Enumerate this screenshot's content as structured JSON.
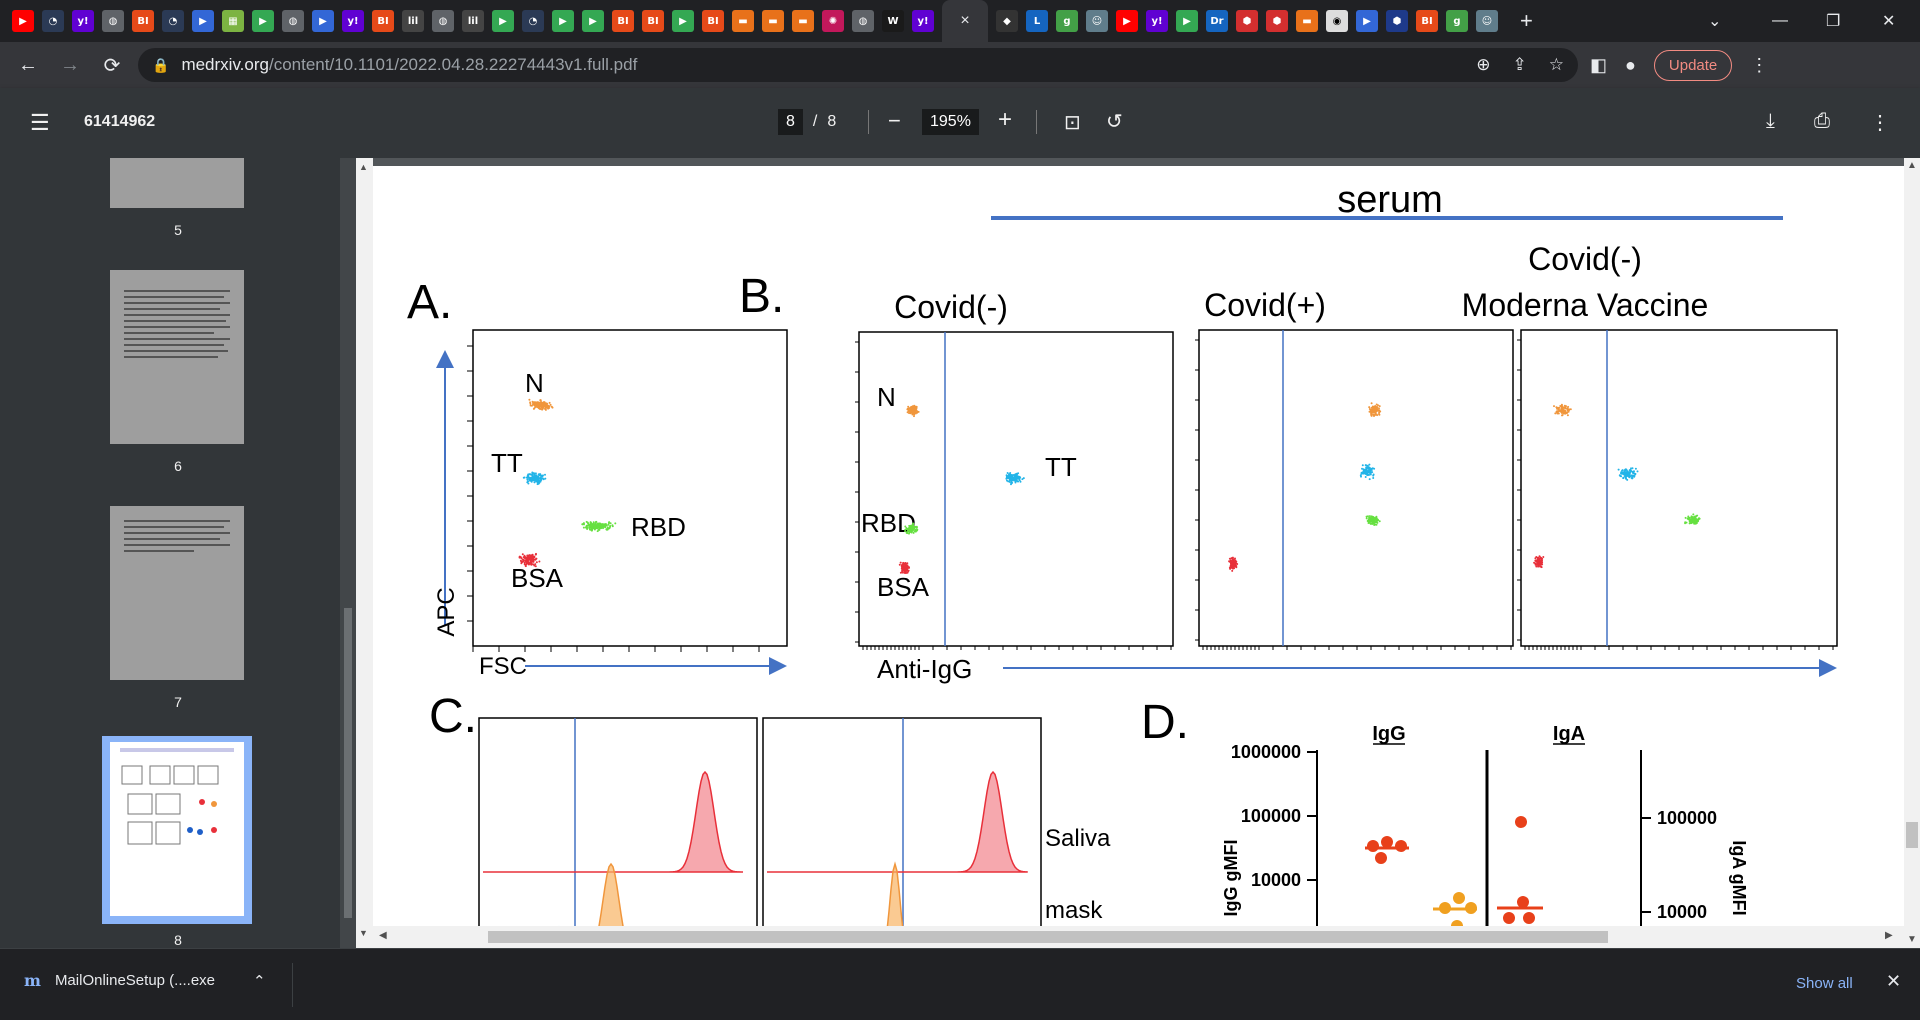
{
  "browser": {
    "tab_icons": [
      "youtube-icon",
      "pin-icon",
      "yahoo-icon",
      "globe-icon",
      "bi-icon",
      "pin-icon",
      "arrow-icon",
      "grid-icon",
      "play-icon",
      "globe-icon",
      "arrow-icon",
      "yahoo-icon",
      "bi-icon",
      "lil-icon",
      "globe-icon",
      "lil-icon",
      "play-icon",
      "pin-icon",
      "play-icon",
      "play-icon",
      "bi-icon",
      "bi-icon",
      "play-icon",
      "bi-icon",
      "bookmark-icon",
      "bookmark-icon",
      "bookmark-icon",
      "spark-icon",
      "globe-icon",
      "ww-icon",
      "yahoo-icon"
    ],
    "active_tab_close": "×",
    "right_tab_icons": [
      "nbc-icon",
      "l-icon",
      "g-icon",
      "avatar-icon",
      "youtube-icon",
      "yahoo-icon",
      "play-icon",
      "dr-icon",
      "pin-red-icon",
      "pin-red-icon",
      "bookmark-icon",
      "wapo-icon",
      "arrow-icon",
      "hex-icon",
      "bi-icon",
      "g-icon",
      "avatar-icon"
    ],
    "new_tab": "+",
    "url_host": "medrxiv.org",
    "url_path": "/content/10.1101/2022.04.28.22274443v1.full.pdf",
    "update_label": "Update"
  },
  "pdf_toolbar": {
    "title": "61414962",
    "page_current": "8",
    "page_sep": "/",
    "page_total": "8",
    "zoom": "195%"
  },
  "sidebar": {
    "thumbnails": [
      {
        "number": "5"
      },
      {
        "number": "6"
      },
      {
        "number": "7"
      },
      {
        "number": "8"
      }
    ]
  },
  "figure": {
    "header": "serum",
    "panel_a": {
      "label": "A.",
      "y_axis": "APC",
      "x_axis": "FSC",
      "populations": [
        "N",
        "TT",
        "RBD",
        "BSA"
      ]
    },
    "panel_b": {
      "label": "B.",
      "x_axis": "Anti-IgG",
      "plots": [
        "Covid(-)",
        "Covid(+)",
        "Covid(-)",
        "Moderna Vaccine"
      ],
      "populations": [
        "N",
        "TT",
        "RBD",
        "BSA"
      ]
    },
    "panel_c": {
      "label": "C.",
      "row_labels": [
        "Saliva",
        "mask"
      ]
    },
    "panel_d": {
      "label": "D.",
      "col_headers": [
        "IgG",
        "IgA"
      ],
      "y_left_label": "IgG gMFI",
      "y_right_label": "IgA gMFI",
      "left_ticks": [
        "1000000",
        "100000",
        "10000"
      ],
      "right_ticks": [
        "100000",
        "10000"
      ]
    }
  },
  "download": {
    "filename": "MailOnlineSetup (....exe",
    "show_all": "Show all"
  },
  "colors": {
    "orange": "#f0963c",
    "cyan": "#22b4e8",
    "green": "#66e040",
    "red": "#e8303a",
    "axis_blue": "#4472c4"
  }
}
